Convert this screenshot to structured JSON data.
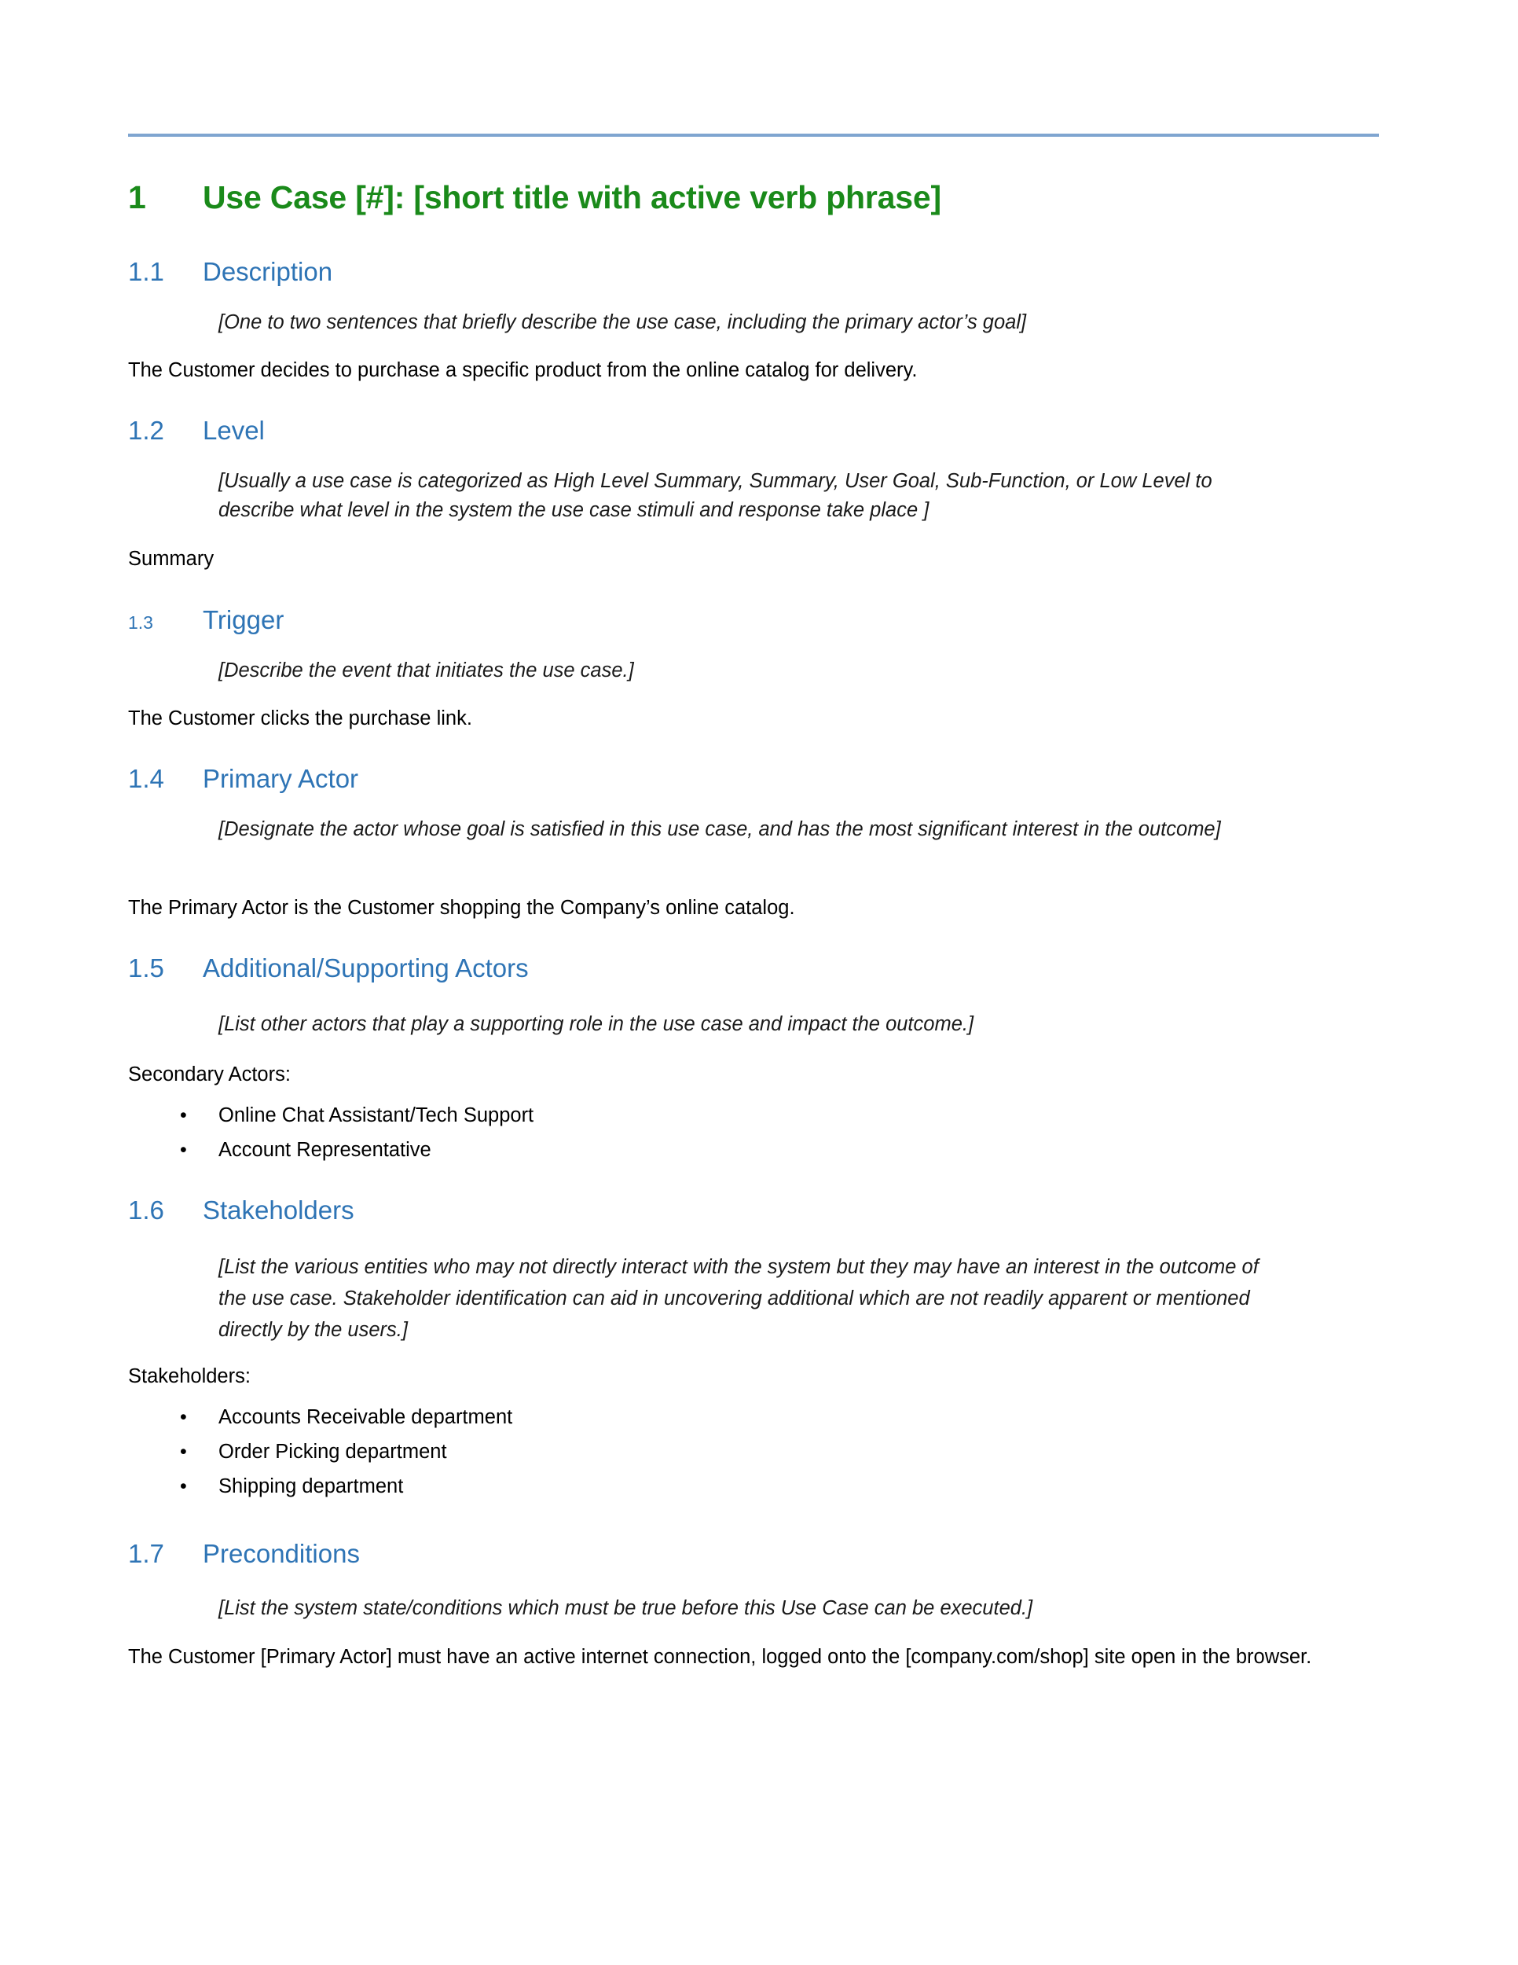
{
  "document": {
    "title_number": "1",
    "title_text": "Use Case [#]:  [short title with active verb phrase]",
    "accent_title_color": "#1A8A1A",
    "accent_heading_color": "#2E74B5",
    "rule_color": "#7FA5D0",
    "sections": [
      {
        "number": "1.1",
        "heading": "Description",
        "guidance": "[One to two sentences that briefly describe the use case, including the primary actor’s goal]",
        "body": "The Customer decides to purchase a specific product from the online catalog for delivery."
      },
      {
        "number": "1.2",
        "heading": "Level",
        "guidance": "[Usually a use case is categorized as High Level Summary, Summary, User Goal, Sub-Function, or Low Level to describe what level in the system the use case stimuli and response take place ]",
        "body": "Summary"
      },
      {
        "number": "1.3",
        "heading": "Trigger",
        "guidance": "[Describe the event that initiates the use case.]",
        "body": "The Customer clicks the purchase link."
      },
      {
        "number": "1.4",
        "heading": "Primary Actor",
        "guidance": "[Designate the actor whose goal is satisfied in this use case, and has the most significant interest in the outcome]",
        "body": "The Primary Actor is the Customer shopping the Company’s online catalog."
      },
      {
        "number": "1.5",
        "heading": "Additional/Supporting Actors",
        "guidance": "[List other actors that play a supporting role in the use case and impact the outcome.]",
        "body": "Secondary Actors:",
        "bullets": [
          "Online Chat Assistant/Tech Support",
          "Account Representative"
        ]
      },
      {
        "number": "1.6",
        "heading": "Stakeholders",
        "guidance": "[List the various entities who may not directly interact with the system but they may have an interest in the outcome of the use case. Stakeholder identification can aid in uncovering additional which are not readily apparent or mentioned directly by the users.]",
        "body": "Stakeholders:",
        "bullets": [
          "Accounts Receivable department",
          "Order Picking department",
          "Shipping department"
        ]
      },
      {
        "number": "1.7",
        "heading": "Preconditions",
        "guidance": "[List the system state/conditions which must be true before this Use Case can be executed.]",
        "body": "The Customer [Primary Actor] must have an active internet connection, logged onto the [company.com/shop] site open in the browser."
      }
    ],
    "bullet_glyph": "•"
  }
}
